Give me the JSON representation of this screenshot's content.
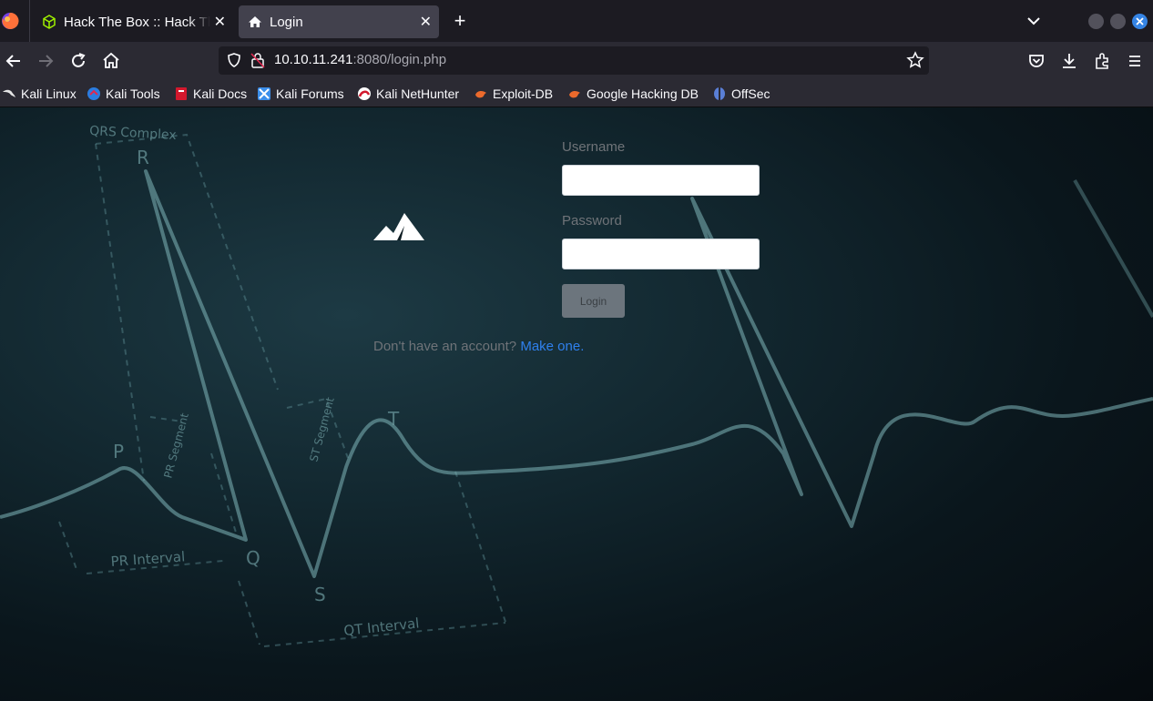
{
  "browser": {
    "tabs": [
      {
        "title": "Hack The Box :: Hack The Box",
        "active": false,
        "icon": "hackthebox-cube-icon"
      },
      {
        "title": "Login",
        "active": true,
        "icon": "home-icon"
      }
    ],
    "url": {
      "host": "10.10.11.241",
      "rest": ":8080/login.php"
    },
    "bookmarks": [
      {
        "label": "Kali Linux",
        "icon": "kali-dragon-icon"
      },
      {
        "label": "Kali Tools",
        "icon": "kali-tools-icon"
      },
      {
        "label": "Kali Docs",
        "icon": "kali-docs-icon"
      },
      {
        "label": "Kali Forums",
        "icon": "kali-forums-icon"
      },
      {
        "label": "Kali NetHunter",
        "icon": "kali-nethunter-icon"
      },
      {
        "label": "Exploit-DB",
        "icon": "exploit-db-icon"
      },
      {
        "label": "Google Hacking DB",
        "icon": "google-hacking-db-icon"
      },
      {
        "label": "OffSec",
        "icon": "offsec-icon"
      }
    ],
    "accent_color": "#3584e4"
  },
  "background_labels": {
    "qrs": "QRS Complex",
    "r": "R",
    "p": "P",
    "q": "Q",
    "s": "S",
    "t": "T",
    "pr_segment": "PR Segment",
    "st_segment": "ST Segment",
    "pr_interval": "PR Interval",
    "qt_interval": "QT Interval"
  },
  "login": {
    "username_label": "Username",
    "username_value": "",
    "password_label": "Password",
    "password_value": "",
    "button_label": "Login",
    "signup_prompt": "Don't have an account?",
    "signup_link": "Make one.",
    "link_color": "#2f80ed",
    "button_color": "#6c757d"
  }
}
